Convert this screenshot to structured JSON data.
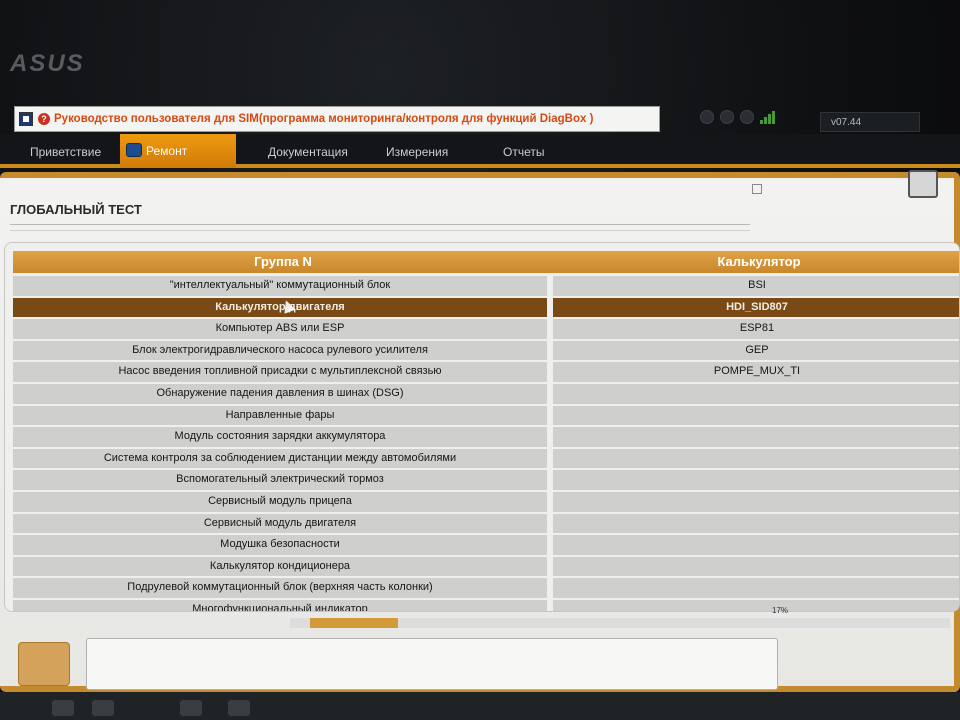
{
  "brand": "ASUS",
  "window": {
    "title": "Руководство пользователя для SIM(программа мониторинга/контроля для  функций DiagBox )",
    "version": "v07.44"
  },
  "tabs": [
    "Приветствие",
    "Ремонт",
    "Документация",
    "Измерения",
    "Отчеты"
  ],
  "page": {
    "title": "ГЛОБАЛЬНЫЙ ТЕСТ",
    "progress_label": "17%",
    "progress": 17
  },
  "table": {
    "columns": [
      "Группа N",
      "Калькулятор"
    ],
    "selected_row": 1,
    "rows": [
      {
        "group": "\"интеллектуальный\" коммутационный блок",
        "calc": "BSI"
      },
      {
        "group": "Калькулятор двигателя",
        "calc": "HDI_SID807"
      },
      {
        "group": "Компьютер ABS или ESP",
        "calc": "ESP81"
      },
      {
        "group": "Блок электрогидравлического насоса рулевого усилителя",
        "calc": "GEP"
      },
      {
        "group": "Насос введения топливной присадки с мультиплексной связью",
        "calc": "POMPE_MUX_TI"
      },
      {
        "group": "Обнаружение падения давления в шинах (DSG)",
        "calc": ""
      },
      {
        "group": "Направленные фары",
        "calc": ""
      },
      {
        "group": "Модуль состояния зарядки аккумулятора",
        "calc": ""
      },
      {
        "group": "Система контроля за соблюдением дистанции между автомобилями",
        "calc": ""
      },
      {
        "group": "Вспомогательный электрический тормоз",
        "calc": ""
      },
      {
        "group": "Сервисный модуль прицепа",
        "calc": ""
      },
      {
        "group": "Сервисный модуль двигателя",
        "calc": ""
      },
      {
        "group": "Модушка безопасности",
        "calc": ""
      },
      {
        "group": "Калькулятор кондиционера",
        "calc": ""
      },
      {
        "group": "Подрулевой коммутационный блок (верхняя часть колонки)",
        "calc": ""
      },
      {
        "group": "Многофункциональный индикатор",
        "calc": ""
      }
    ]
  }
}
